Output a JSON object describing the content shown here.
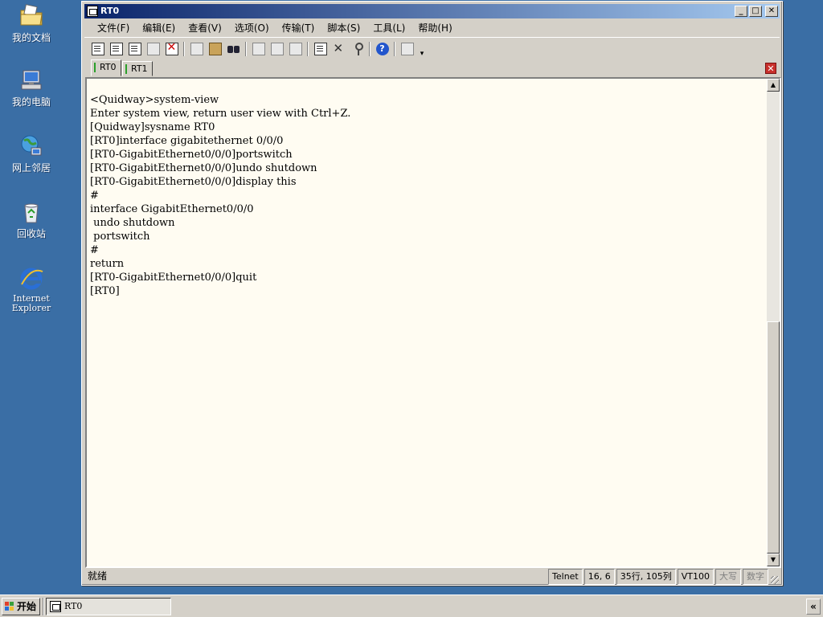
{
  "desktop": {
    "icons": [
      {
        "label": "我的文档",
        "icon": "folder-documents-icon"
      },
      {
        "label": "我的电脑",
        "icon": "computer-icon"
      },
      {
        "label": "网上邻居",
        "icon": "network-icon"
      },
      {
        "label": "回收站",
        "icon": "recycle-bin-icon"
      },
      {
        "label": "Internet\nExplorer",
        "icon": "internet-explorer-icon"
      }
    ]
  },
  "window": {
    "title": "RT0",
    "controls": {
      "minimize": "_",
      "maximize": "□",
      "close": "✕"
    }
  },
  "menu": {
    "items": [
      "文件(F)",
      "编辑(E)",
      "查看(V)",
      "选项(O)",
      "传输(T)",
      "脚本(S)",
      "工具(L)",
      "帮助(H)"
    ]
  },
  "toolbar": {
    "buttons": [
      "connect-icon",
      "quick-connect-icon",
      "connect-tab-icon",
      "reconnect-icon",
      "disconnect-icon",
      "copy-icon",
      "paste-icon",
      "find-icon",
      "print-icon",
      "print-selection-icon",
      "print-setup-icon",
      "session-options-icon",
      "global-options-icon",
      "key-icon",
      "help-icon",
      "keymap-icon"
    ],
    "overflow": "▾"
  },
  "tabs": [
    {
      "label": "RT0",
      "active": true
    },
    {
      "label": "RT1",
      "active": false
    }
  ],
  "tab_close": "✕",
  "terminal": {
    "lines": [
      "<Quidway>system-view",
      "Enter system view, return user view with Ctrl+Z.",
      "[Quidway]sysname RT0",
      "[RT0]interface gigabitethernet 0/0/0",
      "[RT0-GigabitEthernet0/0/0]portswitch",
      "[RT0-GigabitEthernet0/0/0]undo shutdown",
      "[RT0-GigabitEthernet0/0/0]display this",
      "#",
      "interface GigabitEthernet0/0/0",
      " undo shutdown",
      " portswitch",
      "#",
      "return",
      "[RT0-GigabitEthernet0/0/0]quit",
      "[RT0]"
    ]
  },
  "scrollbar": {
    "up": "▲",
    "down": "▼"
  },
  "status": {
    "ready": "就绪",
    "protocol": "Telnet",
    "cursor": "16,   6",
    "size": "35行, 105列",
    "emulation": "VT100",
    "caps": "大写",
    "num": "数字"
  },
  "taskbar": {
    "start_label": "开始",
    "task_label": "RT0",
    "tray_chevron": "«"
  },
  "colors": {
    "desktop": "#3a6ea5",
    "terminal_bg": "#fffcf2",
    "titlebar_start": "#0a246a",
    "titlebar_end": "#a6caf0"
  }
}
